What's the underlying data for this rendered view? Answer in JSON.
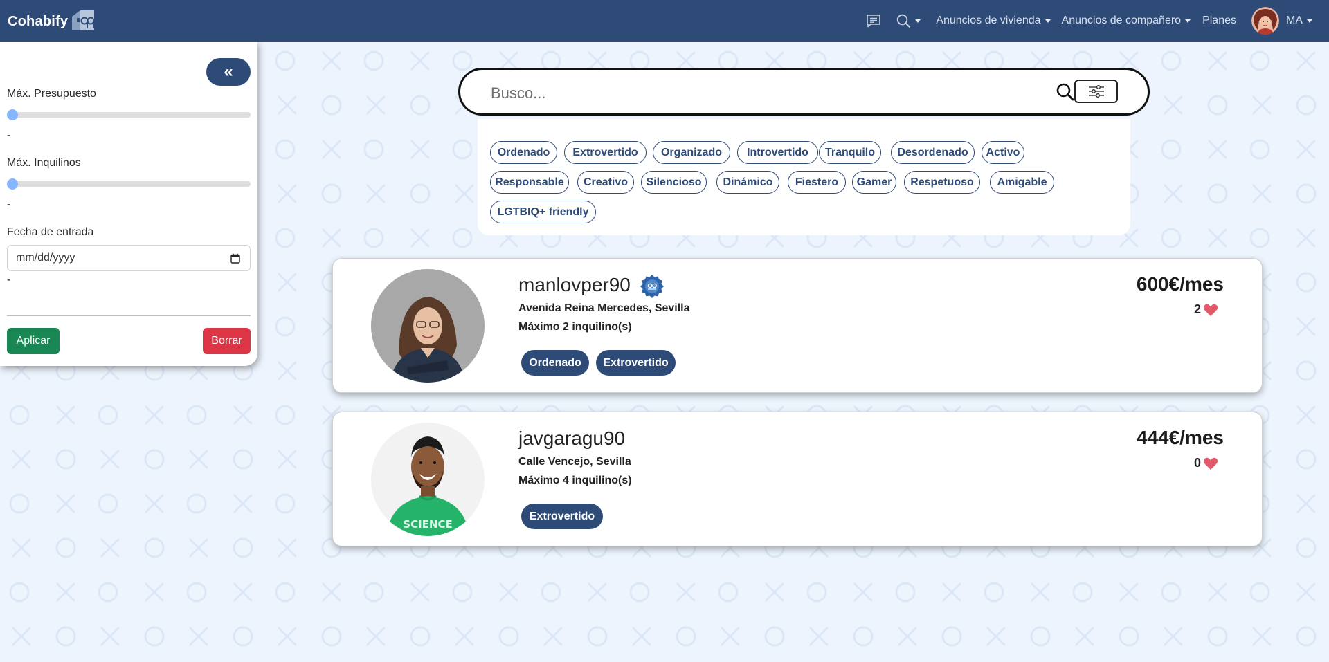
{
  "navbar": {
    "brand": "Cohabify",
    "links": {
      "housing": "Anuncios de vivienda",
      "roommates": "Anuncios de compañero",
      "plans": "Planes",
      "user_initials": "MA"
    }
  },
  "sidebar": {
    "collapse_label": "«",
    "max_budget_label": "Máx. Presupuesto",
    "max_budget_value": "-",
    "max_budget_level": 0,
    "max_tenants_label": "Máx. Inquilinos",
    "max_tenants_value": "-",
    "max_tenants_level": 0,
    "date_label": "Fecha de entrada",
    "date_placeholder": "mm/dd/yyyy",
    "date_value": "-",
    "apply_label": "Aplicar",
    "clear_label": "Borrar"
  },
  "search": {
    "placeholder": "Busco..."
  },
  "tags": [
    "Ordenado",
    "Extrovertido",
    "Organizado",
    "Introvertido",
    "Tranquilo",
    "Desordenado",
    "Activo",
    "Responsable",
    "Creativo",
    "Silencioso",
    "Dinámico",
    "Fiestero",
    "Gamer",
    "Respetuoso",
    "Amigable",
    "LGTBIQ+ friendly"
  ],
  "listings": [
    {
      "username": "manlovper90",
      "verified": true,
      "address": "Avenida Reina Mercedes, Sevilla",
      "tenants": "Máximo 2 inquilino(s)",
      "tags": [
        "Ordenado",
        "Extrovertido"
      ],
      "price": "600€/mes",
      "likes": "2"
    },
    {
      "username": "javgaragu90",
      "verified": false,
      "address": "Calle Vencejo, Sevilla",
      "tenants": "Máximo 4 inquilino(s)",
      "tags": [
        "Extrovertido"
      ],
      "price": "444€/mes",
      "likes": "0"
    }
  ],
  "colors": {
    "navbar": "#2e4a76",
    "background": "#edf4fd",
    "apply": "#198754",
    "clear": "#dc3545",
    "heart": "#e05a6b"
  }
}
